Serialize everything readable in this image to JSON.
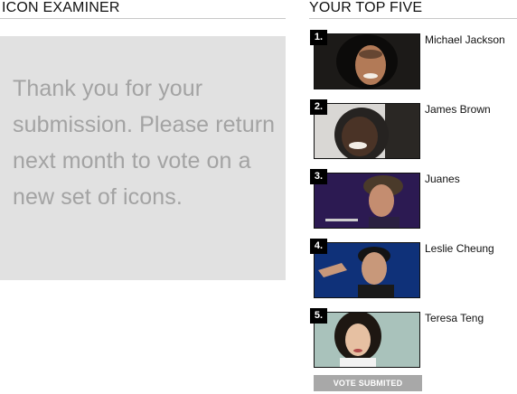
{
  "examiner": {
    "title": "ICON EXAMINER",
    "message": "Thank you for your submission.  Please return next month to vote on a new set of icons."
  },
  "top_five": {
    "title": "YOUR TOP FIVE",
    "items": [
      {
        "rank": "1.",
        "name": "Michael Jackson",
        "icon": "portrait-photo"
      },
      {
        "rank": "2.",
        "name": "James Brown",
        "icon": "portrait-photo"
      },
      {
        "rank": "3.",
        "name": "Juanes",
        "icon": "portrait-photo"
      },
      {
        "rank": "4.",
        "name": "Leslie Cheung",
        "icon": "portrait-photo"
      },
      {
        "rank": "5.",
        "name": "Teresa Teng",
        "icon": "portrait-photo"
      }
    ],
    "button_label": "VOTE SUBMITED"
  }
}
